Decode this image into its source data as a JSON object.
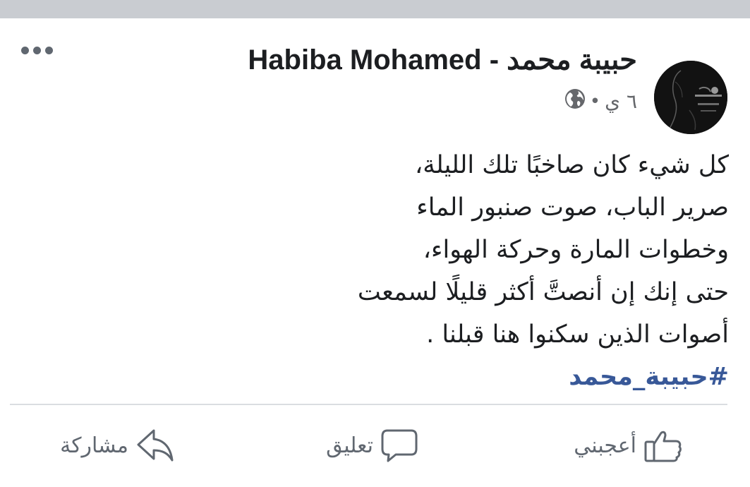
{
  "post": {
    "author": "Habiba Mohamed - حبيبة محمد",
    "time": "٦ ي",
    "separator": "•",
    "privacy_icon": "globe-icon",
    "options_icon": "more-options-icon",
    "lines": [
      "كل شيء كان صاخبًا تلك الليلة،",
      "صرير الباب، صوت صنبور الماء",
      "وخطوات المارة وحركة الهواء،",
      "حتى إنك إن أنصتَّ أكثر قليلًا لسمعت",
      "أصوات الذين سكنوا هنا قبلنا ."
    ],
    "hashtag": "#حبيبة_محمد"
  },
  "actions": {
    "like": {
      "label": "أعجبني",
      "icon": "thumbs-up-icon"
    },
    "comment": {
      "label": "تعليق",
      "icon": "comment-icon"
    },
    "share": {
      "label": "مشاركة",
      "icon": "share-icon"
    }
  },
  "colors": {
    "text": "#1c1e21",
    "secondary": "#65676b",
    "hashtag": "#385898",
    "divider": "#dadde1",
    "top_bar": "#c9ccd1"
  }
}
